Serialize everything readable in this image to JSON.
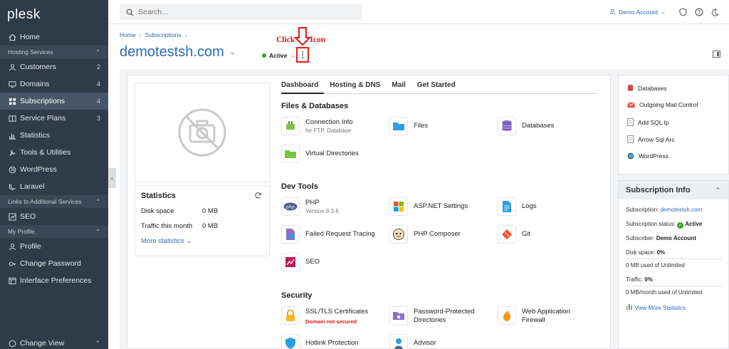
{
  "app": {
    "logo": "plesk"
  },
  "sidebar": {
    "home": "Home",
    "sections": {
      "hosting": "Hosting Services",
      "links": "Links to Additional Services",
      "profile": "My Profile"
    },
    "hosting_items": [
      {
        "label": "Customers",
        "count": "2"
      },
      {
        "label": "Domains",
        "count": "4"
      },
      {
        "label": "Subscriptions",
        "count": "4"
      },
      {
        "label": "Service Plans",
        "count": "3"
      },
      {
        "label": "Statistics",
        "count": ""
      },
      {
        "label": "Tools & Utilities",
        "count": ""
      },
      {
        "label": "WordPress",
        "count": ""
      },
      {
        "label": "Laravel",
        "count": ""
      }
    ],
    "links_items": [
      {
        "label": "SEO"
      }
    ],
    "profile_items": [
      {
        "label": "Profile"
      },
      {
        "label": "Change Password"
      },
      {
        "label": "Interface Preferences"
      }
    ],
    "footer": "Change View"
  },
  "topbar": {
    "search_placeholder": "Search...",
    "account": "Demo Account"
  },
  "page": {
    "breadcrumb": [
      "Home",
      "Subscriptions"
    ],
    "title": "demotestsh.com",
    "status": "Active",
    "annotation": "Click the Icon"
  },
  "overview": {
    "stats_title": "Statistics",
    "disk_label": "Disk space",
    "disk_value": "0 MB",
    "traffic_label": "Traffic this month",
    "traffic_value": "0 MB",
    "more_stats": "More statistics"
  },
  "tabs": [
    "Dashboard",
    "Hosting & DNS",
    "Mail",
    "Get Started"
  ],
  "groups": {
    "files": {
      "title": "Files & Databases",
      "tools": [
        {
          "label": "Connection Info",
          "sub": "for FTP, Database"
        },
        {
          "label": "Files",
          "sub": ""
        },
        {
          "label": "Databases",
          "sub": ""
        },
        {
          "label": "Virtual Directories",
          "sub": ""
        }
      ]
    },
    "dev": {
      "title": "Dev Tools",
      "tools": [
        {
          "label": "PHP",
          "sub": "Version 8.3.6"
        },
        {
          "label": "ASP.NET Settings",
          "sub": ""
        },
        {
          "label": "Logs",
          "sub": ""
        },
        {
          "label": "Failed Request Tracing",
          "sub": ""
        },
        {
          "label": "PHP Composer",
          "sub": ""
        },
        {
          "label": "Git",
          "sub": ""
        },
        {
          "label": "SEO",
          "sub": ""
        }
      ]
    },
    "security": {
      "title": "Security",
      "tools": [
        {
          "label": "SSL/TLS Certificates",
          "badge": "Domain not secured"
        },
        {
          "label": "Password-Protected Directories"
        },
        {
          "label": "Web Application Firewall"
        },
        {
          "label": "Hotlink Protection"
        },
        {
          "label": "Advisor"
        }
      ]
    }
  },
  "quick_links": [
    "Databases",
    "Outgoing Mail Control",
    "Add SQL Ip",
    "Arrow Sql Arc",
    "WordPress"
  ],
  "subscription_info": {
    "title": "Subscription Info",
    "subscription_label": "Subscription:",
    "subscription_value": "demotestsh.com",
    "status_label": "Subscription status:",
    "status_value": "Active",
    "subscriber_label": "Subscriber:",
    "subscriber_value": "Demo Account",
    "disk_label": "Disk space:",
    "disk_value": "0%",
    "disk_usage": "0 MB used of Unlimited",
    "traffic_label": "Traffic:",
    "traffic_value": "0%",
    "traffic_usage": "0 MB/month used of Unlimited",
    "view_more": "View More Statistics"
  },
  "colors": {
    "sidebar": "#2f3b49",
    "link": "#2a6bb3",
    "annotation": "#d81d17",
    "active": "#3a9d2b"
  }
}
